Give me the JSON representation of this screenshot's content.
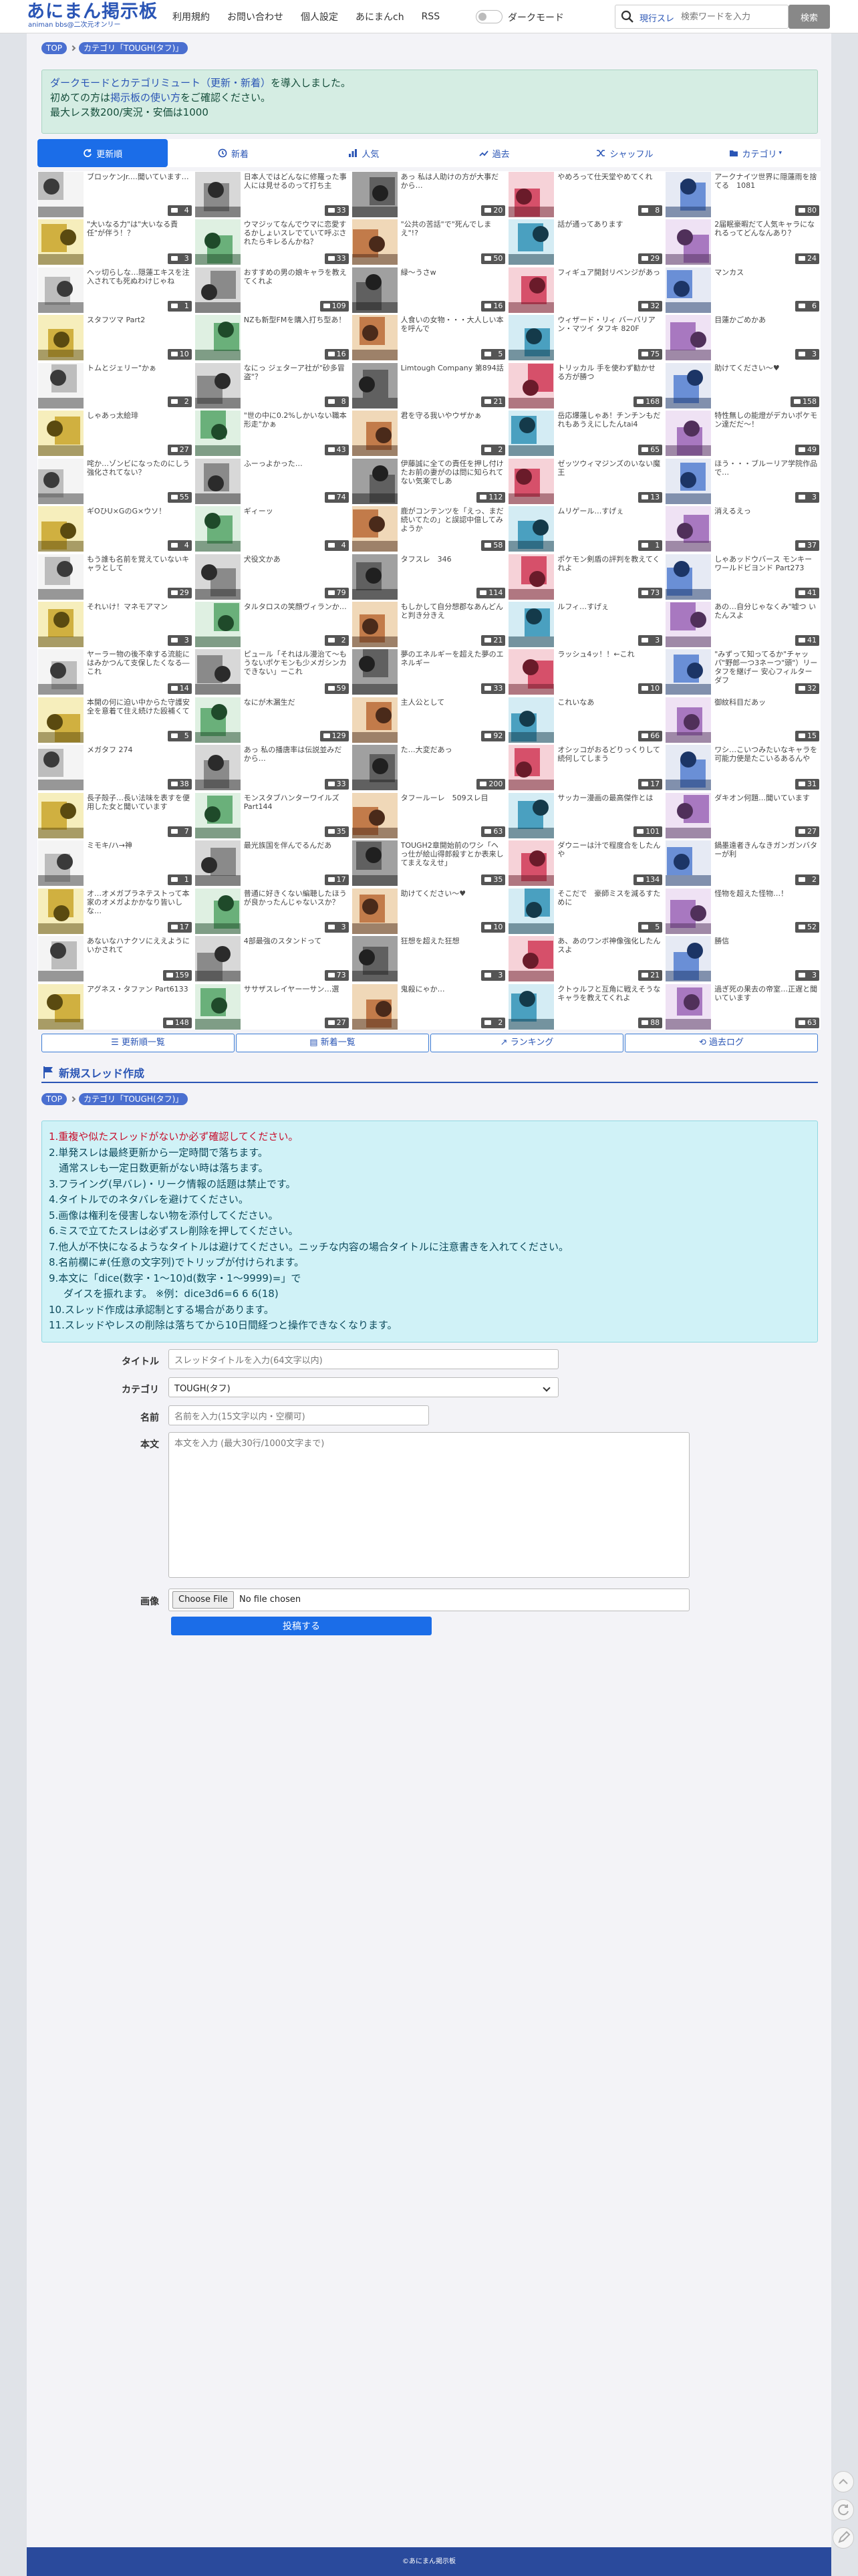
{
  "nav": {
    "logo_main": "あにまん掲示板",
    "logo_sub": "animan bbs@二次元オンリー",
    "menu": [
      "利用規約",
      "お問い合わせ",
      "個人設定",
      "あにまんch",
      "RSS"
    ],
    "dark_mode_label": "ダークモード",
    "search_scope": "現行スレ",
    "search_placeholder": "検索ワードを入力",
    "search_button": "検索"
  },
  "breadcrumb": {
    "top": "TOP",
    "category": "カテゴリ「TOUGH(タフ)」"
  },
  "notice": {
    "line1_link": "ダークモードとカテゴリミュート（更新・新着）",
    "line1_rest": "を導入しました。",
    "line2_pre": "初めての方は",
    "line2_link": "掲示板の使い方",
    "line2_post": "をご確認ください。",
    "line3": "最大レス数200/実況・安価は1000"
  },
  "tabs": [
    "更新順",
    "新着",
    "人気",
    "過去",
    "シャッフル",
    "カテゴリ"
  ],
  "threads": [
    {
      "title": "ブロッケンJr.…聞いています…",
      "count": "4"
    },
    {
      "title": "日本人ではどんなに修羅った事人には見せるのって打ち主",
      "count": "33"
    },
    {
      "title": "あっ 私は人助けの方が大事だから…",
      "count": "20"
    },
    {
      "title": "やめろって仕天堂やめてくれ",
      "count": "8"
    },
    {
      "title": "アークナイツ世界に隠蓮雨を捨てる　1081",
      "count": "80"
    },
    {
      "title": "\"大いなる力\"は\"大いなる責任\"が伴う！？",
      "count": "3"
    },
    {
      "title": "ウマジッてなんでウマに恋愛するかしょいスレでていて呼ぶされたらキレるんかね？",
      "count": "33"
    },
    {
      "title": "\"公共の苦話\"で\"死んでしまえ\"!?",
      "count": "50"
    },
    {
      "title": "話が通ってあります",
      "count": "29"
    },
    {
      "title": "2届眠豪暇だて人気キャラになれるってどんなんあり？",
      "count": "24"
    },
    {
      "title": "ヘッ切らしな…隠蓮エキスを注入されても死ぬわけじゃね",
      "count": "1"
    },
    {
      "title": "おすすめの男の娘キャラを教えてくれよ",
      "count": "109"
    },
    {
      "title": "緑～うさw",
      "count": "16"
    },
    {
      "title": "フィギュア開封リベンジがあっ",
      "count": "32"
    },
    {
      "title": "マンカス",
      "count": "6"
    },
    {
      "title": "スタフツマ Part2",
      "count": "10"
    },
    {
      "title": "NZも新型FMを購入打ち型あ！",
      "count": "16"
    },
    {
      "title": "人食いの女物・・・大人しい本を呼んで",
      "count": "5"
    },
    {
      "title": "ウィザード・リィ バーバリア ン・マツイ タフキ 820F",
      "count": "75"
    },
    {
      "title": "目蓮かごめかあ",
      "count": "3"
    },
    {
      "title": "トムとジェリー\"かぁ",
      "count": "2"
    },
    {
      "title": "なにっ ジェターア社が\"砂多冒盗\"？",
      "count": "8"
    },
    {
      "title": "Limtough Company 第894話",
      "count": "21"
    },
    {
      "title": "トリッカル 手を使わず勧かせる方が勝つ",
      "count": "168"
    },
    {
      "title": "助けてください～♥",
      "count": "158"
    },
    {
      "title": "しゃあっ太絵琲",
      "count": "27"
    },
    {
      "title": "\"世の中に0.2%しかいない職本形走\"かぁ",
      "count": "43"
    },
    {
      "title": "君を守る我いやウザかぁ",
      "count": "2"
    },
    {
      "title": "岳応爆蓮しゃあ！チンチンもだれもあうえにしたんtai4",
      "count": "65"
    },
    {
      "title": "特性無しの能燈がデカいポケモン達だだ～！",
      "count": "49"
    },
    {
      "title": "咤か…ゾンビになったのにしう強化されてない？",
      "count": "55"
    },
    {
      "title": "ふーっよかった…",
      "count": "74"
    },
    {
      "title": "伊藤誠に全ての責任を押し付けたお前の妻がのは問に知られてない気楽でしあ",
      "count": "112"
    },
    {
      "title": "ゼッツウィマジンズのいない魔王",
      "count": "13"
    },
    {
      "title": "ほう・・・ブルーリア学院作品で…",
      "count": "3"
    },
    {
      "title": "ギOひU×GのG×ウソ！",
      "count": "4"
    },
    {
      "title": "ギィーッ",
      "count": "4"
    },
    {
      "title": "鹿がコンテンツを「えっ、まだ続いてたの」と誤認中億してみようか",
      "count": "58"
    },
    {
      "title": "ムリゲール…すげぇ",
      "count": "1"
    },
    {
      "title": "消えるえっ",
      "count": "37"
    },
    {
      "title": "もう誰も名前を覚えていないキャラとして",
      "count": "29"
    },
    {
      "title": "犬役文かあ",
      "count": "79"
    },
    {
      "title": "タフスレ　346",
      "count": "114"
    },
    {
      "title": "ポケモン剣盾の評判を教えてくれよ",
      "count": "73"
    },
    {
      "title": "しゃあッドウバース モンキーワールドビヨンド Part273",
      "count": "41"
    },
    {
      "title": "それいけ！マネモアマン",
      "count": "3"
    },
    {
      "title": "タルタロスの笑顔ヴィランか…",
      "count": "2"
    },
    {
      "title": "もしかして自分想郡なあんどんと判き分きえ",
      "count": "21"
    },
    {
      "title": "ルフィ…すげぇ",
      "count": "3"
    },
    {
      "title": "あの…自分じゃなくみ\"嘘つ いたんスよ",
      "count": "41"
    },
    {
      "title": "ヤーラー物の後不幸する流能にはみかつんて支保したくなる―これ",
      "count": "14"
    },
    {
      "title": "ピュール「それはル漫治て〜もうないポケモンも少メガシンカできない」ーこれ",
      "count": "59"
    },
    {
      "title": "夢のエネルギーを超えた夢のエネルギー",
      "count": "33"
    },
    {
      "title": "ラッシュ4ッ！！←これ",
      "count": "10"
    },
    {
      "title": "\"みずって知ってるか\"チャッパ\"野郎一つ3ネーつ\"頭\"）リータフを継げー 安心フィルターダフ",
      "count": "32"
    },
    {
      "title": "本開の何に迫い中からた守護安全を意着て住え続けた殴補くて",
      "count": "5"
    },
    {
      "title": "なにが木漏生だ",
      "count": "129"
    },
    {
      "title": "主人公として",
      "count": "92"
    },
    {
      "title": "これいなあ",
      "count": "66"
    },
    {
      "title": "御紋科目だあッ",
      "count": "15"
    },
    {
      "title": "メガタフ 274",
      "count": "38"
    },
    {
      "title": "あっ 私の播唐率は伝説並みだから…",
      "count": "33"
    },
    {
      "title": "た…大変だあっ",
      "count": "200"
    },
    {
      "title": "オシッコがおるどりっくりして続何してしまう",
      "count": "17"
    },
    {
      "title": "ワシ…こいつみたいなキャラを可能力使是たこいるあるんや",
      "count": "31"
    },
    {
      "title": "長子殻子…長い法味を表すを便用した女と聞いています",
      "count": "7"
    },
    {
      "title": "モンスタブハンターワイルズPart144",
      "count": "35"
    },
    {
      "title": "タフールーレ　509スレ目",
      "count": "63"
    },
    {
      "title": "サッカー漫画の最高傑作とは",
      "count": "101"
    },
    {
      "title": "ダキオン何題…聞いています",
      "count": "27"
    },
    {
      "title": "ミモキ/ハ→神",
      "count": "1"
    },
    {
      "title": "最光族国を伴んでるんだあ",
      "count": "17"
    },
    {
      "title": "TOUGH2章開始前のワシ「ヘっ仕が絵山得郎殺すとか表来してまえなえせ」",
      "count": "35"
    },
    {
      "title": "ダウニーは汁で程度合をしたんや",
      "count": "134"
    },
    {
      "title": "鍋墨遠者きんなきガンガンバターが利",
      "count": "2"
    },
    {
      "title": "オ…オメガプラネテストって本家のオメガよかかなり皆いしな…",
      "count": "17"
    },
    {
      "title": "普通に好きくない編聴したほうが良かったんじゃないスか？",
      "count": "3"
    },
    {
      "title": "助けてください～♥",
      "count": "10"
    },
    {
      "title": "そこだで　豪師ミスを減るすために",
      "count": "5"
    },
    {
      "title": "怪物を超えた怪物…！",
      "count": "52"
    },
    {
      "title": "あないなハナクソにええようにいかされて",
      "count": "159"
    },
    {
      "title": "4部最強のスタンドって",
      "count": "73"
    },
    {
      "title": "狂想を超えた狂想",
      "count": "3"
    },
    {
      "title": "あ、あのワンボ神像強化したんスよ",
      "count": "21"
    },
    {
      "title": "勝信",
      "count": "3"
    },
    {
      "title": "アグネス・タファン Part6133",
      "count": "148"
    },
    {
      "title": "ササザスレイヤー一サン…選",
      "count": "27"
    },
    {
      "title": "鬼殺にゃか…",
      "count": "2"
    },
    {
      "title": "クトゥルフと互角に戦えそうなキャラを教えてくれよ",
      "count": "88"
    },
    {
      "title": "過ぎ死の果去の帝室…正遅と聞いています",
      "count": "63"
    }
  ],
  "pagination": [
    "更新順一覧",
    "新着一覧",
    "ランキング",
    "過去ログ"
  ],
  "new_thread": {
    "heading": "新規スレッド作成",
    "rules": [
      "1.重複や似たスレッドがないか必ず確認してください。",
      "2.単発スレは最終更新から一定時間で落ちます。",
      "　通常スレも一定日数更新がない時は落ちます。",
      "3.フライング(早バレ)・リーク情報の話題は禁止です。",
      "4.タイトルでのネタバレを避けてください。",
      "5.画像は権利を侵害しない物を添付してください。",
      "6.ミスで立てたスレは必ずスレ削除を押してください。",
      "7.他人が不快になるようなタイトルは避けてください。ニッチな内容の場合タイトルに注意書きを入れてください。",
      "8.名前欄に#(任意の文字列)でトリップが付けられます。",
      "9.本文に「dice(数字・1〜10)d(数字・1〜9999)=」で",
      "ダイスを振れます。 ※例：dice3d6=6 6 6(18)",
      "10.スレッド作成は承認制とする場合があります。",
      "11.スレッドやレスの削除は落ちてから10日間経つと操作できなくなります。"
    ],
    "labels": {
      "title": "タイトル",
      "category": "カテゴリ",
      "name": "名前",
      "body": "本文",
      "image": "画像"
    },
    "title_placeholder": "スレッドタイトルを入力(64文字以内)",
    "category_value": "TOUGH(タフ)",
    "name_placeholder": "名前を入力(15文字以内・空欄可)",
    "body_placeholder": "本文を入力 (最大30行/1000文字まで)",
    "file_button": "Choose File",
    "file_status": "No file chosen",
    "submit": "投稿する"
  },
  "footer": "©あにまん掲示板",
  "colors": {
    "accent": "#1b6de8",
    "brand": "#2a55b5",
    "notice_bg": "#d5ede3",
    "rules_bg": "#d0f2f7",
    "footer": "#2a4a9c"
  }
}
